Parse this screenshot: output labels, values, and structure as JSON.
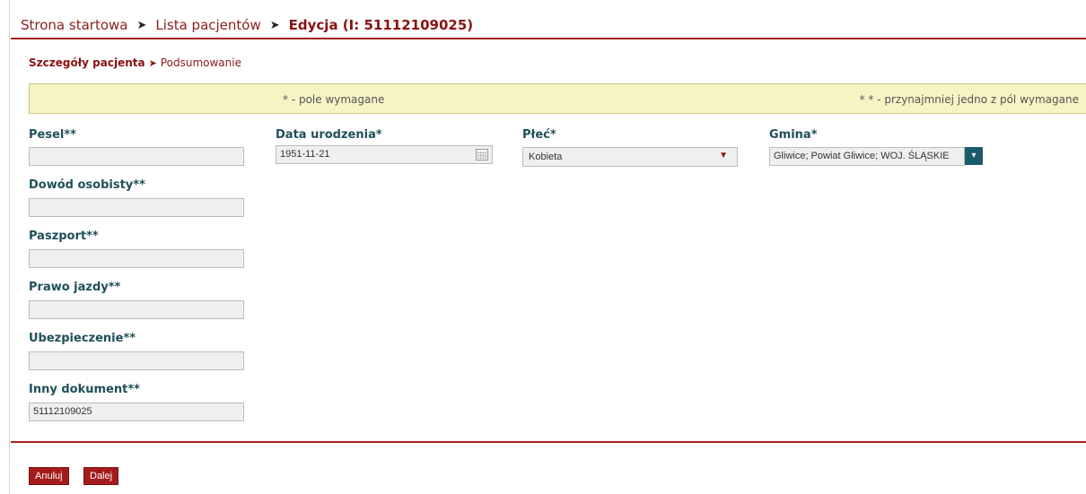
{
  "breadcrumb": {
    "home": "Strona startowa",
    "patients": "Lista pacjentów",
    "current": "Edycja (I: 51112109025)",
    "separator": "➤"
  },
  "steps": {
    "current": "Szczegóły pacjenta",
    "separator": "➤",
    "next": "Podsumowanie"
  },
  "notice": {
    "required": "* - pole wymagane",
    "at_least_one": "* * - przynajmniej jedno z pól wymagane"
  },
  "fields": {
    "pesel": {
      "label": "Pesel**",
      "value": ""
    },
    "dowod": {
      "label": "Dowód osobisty**",
      "value": ""
    },
    "paszport": {
      "label": "Paszport**",
      "value": ""
    },
    "prawo_jazdy": {
      "label": "Prawo jazdy**",
      "value": ""
    },
    "ubezpieczenie": {
      "label": "Ubezpieczenie**",
      "value": ""
    },
    "inny_dokument": {
      "label": "Inny dokument**",
      "value": "51112109025"
    },
    "data_urodzenia": {
      "label": "Data urodzenia*",
      "value": "1951-11-21"
    },
    "plec": {
      "label": "Płeć*",
      "value": "Kobieta",
      "arrow": "▼"
    },
    "gmina": {
      "label": "Gmina*",
      "value": "Gliwice; Powiat Gliwice; WOJ. ŚLĄSKIE"
    }
  },
  "buttons": {
    "cancel": "Anuluj",
    "next": "Dalej"
  },
  "colors": {
    "accent": "#a51b1b",
    "label": "#1f4f5a",
    "notice_bg": "#f7f3c4"
  }
}
